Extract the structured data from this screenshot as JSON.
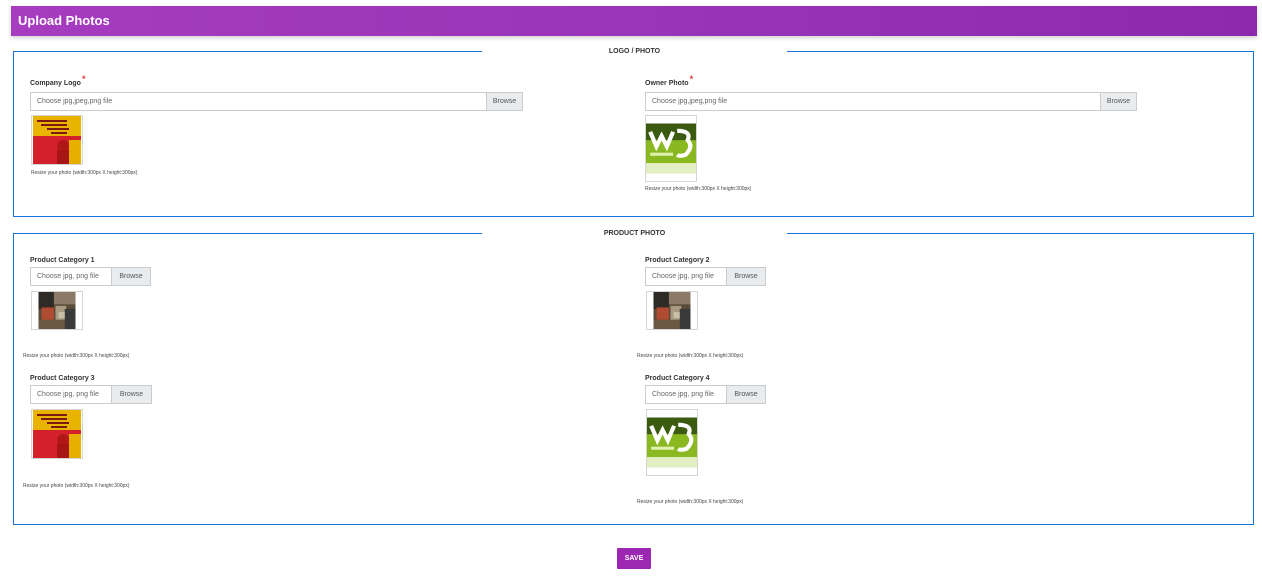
{
  "header": {
    "title": "Upload Photos"
  },
  "logo_section": {
    "legend": "LOGO / PHOTO",
    "company_logo": {
      "label": "Company Logo",
      "required_mark": "*",
      "placeholder": "Choose jpg,jpeg,png file",
      "browse_label": "Browse",
      "hint": "Resize your photo (width:300px X height:300px)"
    },
    "owner_photo": {
      "label": "Owner Photo",
      "required_mark": "*",
      "placeholder": "Choose jpg,jpeg,png file",
      "browse_label": "Browse",
      "hint": "Resize your photo (width:300px X height:300px)"
    }
  },
  "product_section": {
    "legend": "PRODUCT PHOTO",
    "categories": [
      {
        "label": "Product Category 1",
        "placeholder": "Choose jpg, png file",
        "browse_label": "Browse",
        "hint": "Resize your photo (width:300px X height:300px)"
      },
      {
        "label": "Product Category 2",
        "placeholder": "Choose jpg, png file",
        "browse_label": "Browse",
        "hint": "Resize your photo (width:300px X height:300px)"
      },
      {
        "label": "Product Category 3",
        "placeholder": "Choose jpg, png file",
        "browse_label": "Browse",
        "hint": "Resize your photo (width:300px X height:300px)"
      },
      {
        "label": "Product Category 4",
        "placeholder": "Choose jpg, png file",
        "browse_label": "Browse",
        "hint": "Resize your photo (width:300px X height:300px)"
      }
    ]
  },
  "save_label": "SAVE",
  "colors": {
    "header": "#9c27b0",
    "border": "#1a73d9",
    "required": "#e53935",
    "save": "#9c27b0"
  }
}
